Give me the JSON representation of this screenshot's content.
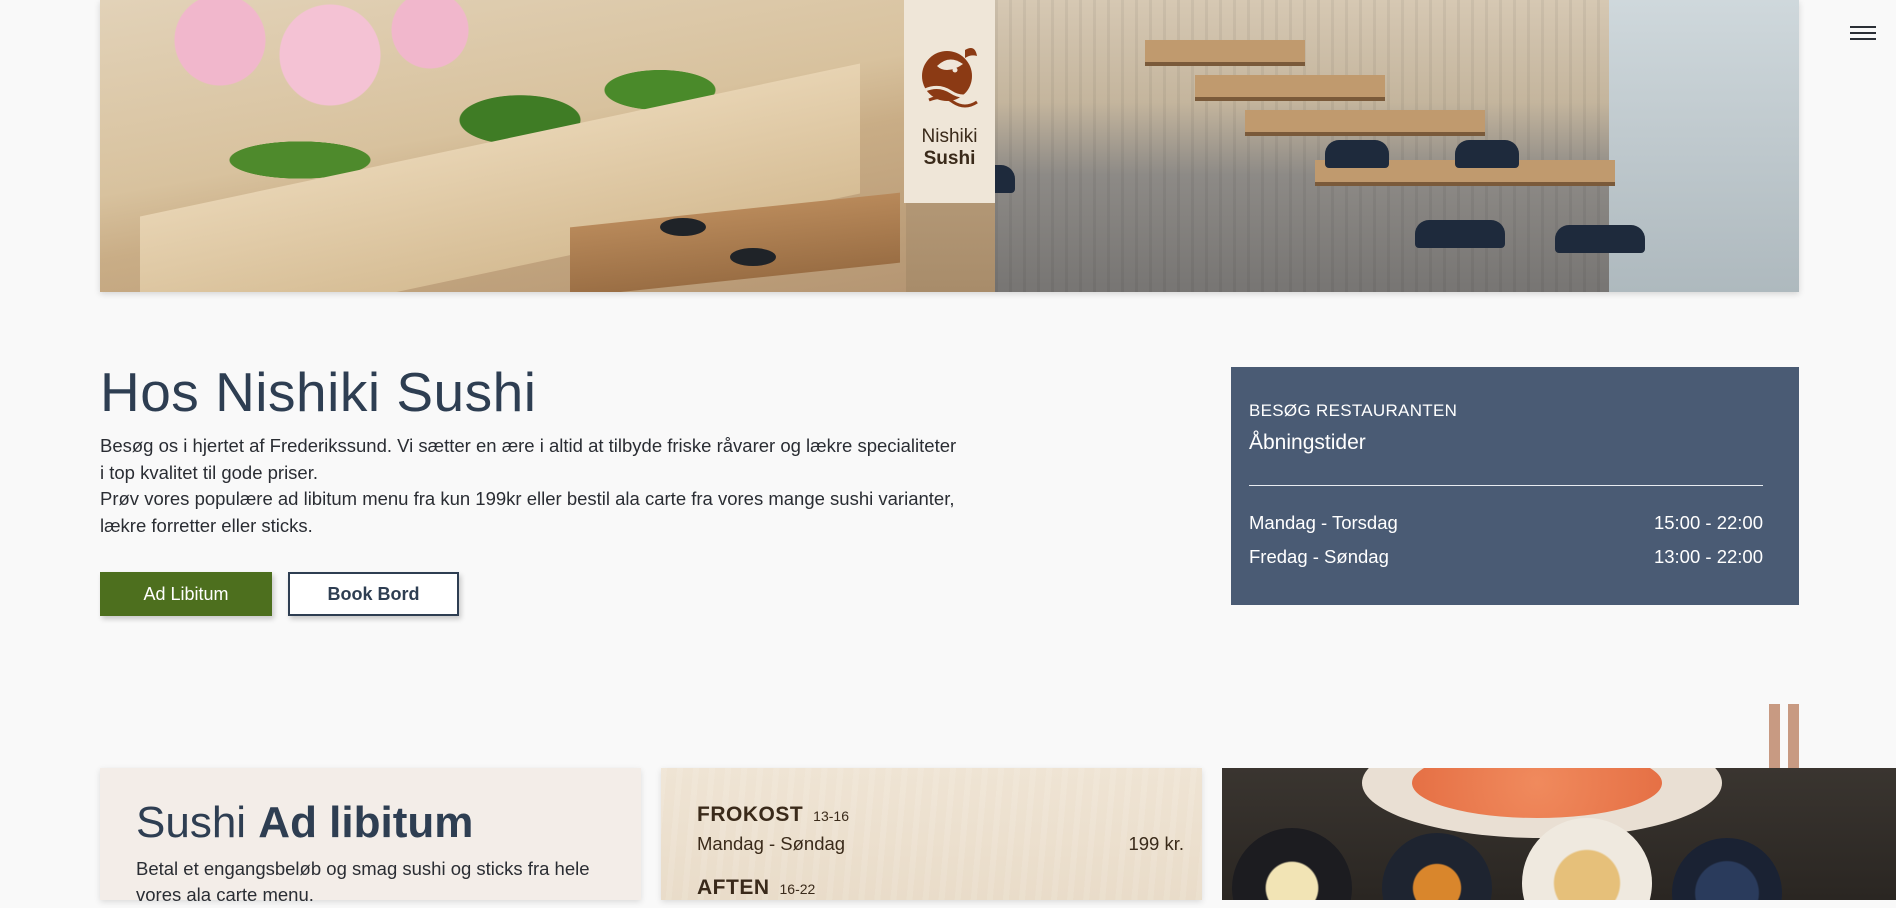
{
  "brand": {
    "line1": "Nishiki",
    "line2": "Sushi"
  },
  "nav": {
    "menu_icon": "hamburger-menu-icon"
  },
  "intro": {
    "title": "Hos Nishiki Sushi",
    "paragraph1": "Besøg os i hjertet af Frederikssund. Vi sætter en ære i altid at tilbyde friske råvarer og lækre specialiteter i top kvalitet til gode priser.",
    "paragraph2": "Prøv vores populære ad libitum menu fra kun 199kr eller bestil ala carte fra vores mange sushi varianter, lækre forretter eller sticks.",
    "primary_button": "Ad Libitum",
    "secondary_button": "Book Bord"
  },
  "hours": {
    "eyebrow": "BESØG RESTAURANTEN",
    "heading": "Åbningstider",
    "rows": [
      {
        "days": "Mandag - Torsdag",
        "time": "15:00 - 22:00"
      },
      {
        "days": "Fredag - Søndag",
        "time": "13:00 - 22:00"
      }
    ]
  },
  "adlibitum": {
    "title_light": "Sushi ",
    "title_bold": "Ad libitum",
    "description": "Betal et engangsbeløb og smag sushi og sticks fra hele vores ala carte menu."
  },
  "pricing": {
    "lunch": {
      "name": "FROKOST",
      "hours": "13-16",
      "days": "Mandag - Søndag",
      "price": "199 kr."
    },
    "dinner": {
      "name": "AFTEN",
      "hours": "16-22"
    }
  },
  "colors": {
    "primary_green": "#4d6f1e",
    "navy": "#2e3e52",
    "hours_card": "#4a5b74",
    "logo_brown": "#8b3a14"
  }
}
